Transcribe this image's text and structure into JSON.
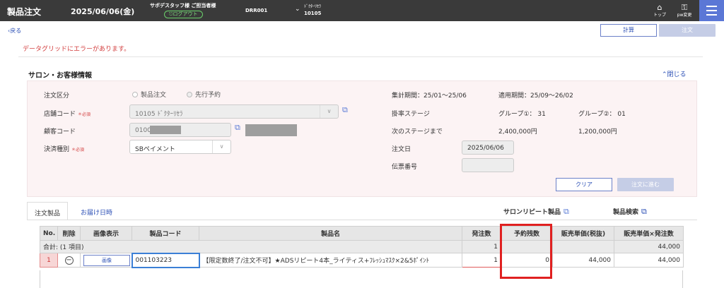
{
  "header": {
    "title": "製品注文",
    "date": "2025/06/06(金)",
    "user": "サポデスタッフ様 ご担当者様",
    "logout": "ログアウト",
    "code": "DRR001",
    "shop_kana": "ﾄﾞｸﾀｰﾘｾﾗ",
    "shop_code": "10105",
    "top_label": "トップ",
    "pw_label": "pw変更"
  },
  "toolbar": {
    "back": "戻る",
    "calc": "計算",
    "order": "注文"
  },
  "error_message": "データグリッドにエラーがあります。",
  "section": {
    "title": "サロン・お客様情報",
    "close": "閉じる"
  },
  "form": {
    "order_type_label": "注文区分",
    "order_type_options": [
      "製品注文",
      "先行予約"
    ],
    "store_code_label": "店舗コード",
    "store_code_value": "10105 ﾄﾞｸﾀｰﾘｾﾗ",
    "customer_code_label": "顧客コード",
    "customer_code_value": "0100",
    "payment_label": "決済種別",
    "payment_value": "SBペイメント",
    "required": "＊必須",
    "period_label": "集計期間：25/01～25/06",
    "applied_period": "適用期間：25/09～26/02",
    "rate_stage_label": "掛率ステージ",
    "group1": "グループ①： 31",
    "group2": "グループ②： 01",
    "next_stage_label": "次のステージまで",
    "next_stage_val1": "2,400,000円",
    "next_stage_val2": "1,200,000円",
    "order_date_label": "注文日",
    "order_date_value": "2025/06/06",
    "slip_label": "伝票番号",
    "slip_value": "",
    "clear": "クリア",
    "proceed": "注文に進む"
  },
  "tabs": {
    "products": "注文製品",
    "delivery": "お届け日時",
    "repeat": "サロンリピート製品",
    "search": "製品検索"
  },
  "grid": {
    "columns": [
      "No.",
      "削除",
      "画像表示",
      "製品コード",
      "製品名",
      "発注数",
      "予約残数",
      "販売単価(税抜)",
      "販売単価×発注数"
    ],
    "summary": {
      "label": "合計: (1 項目)",
      "qty": "1",
      "total": "44,000"
    },
    "rows": [
      {
        "no": "1",
        "image_label": "画像",
        "code": "001103223",
        "name": "【限定数終了/注文不可】★ADSリピート4本_ライティス+ﾌﾚｯｼｭﾏｽｸ×2&5ﾎﾟｲﾝﾄ",
        "qty": "1",
        "reserve": "0",
        "unit_price": "44,000",
        "amount": "44,000"
      }
    ]
  },
  "colors": {
    "header_bg": "#3a3a3a",
    "accent": "#2b4fb5",
    "error": "#d34040",
    "panel_bg": "#fcf3f4",
    "highlight": "#e02020"
  }
}
